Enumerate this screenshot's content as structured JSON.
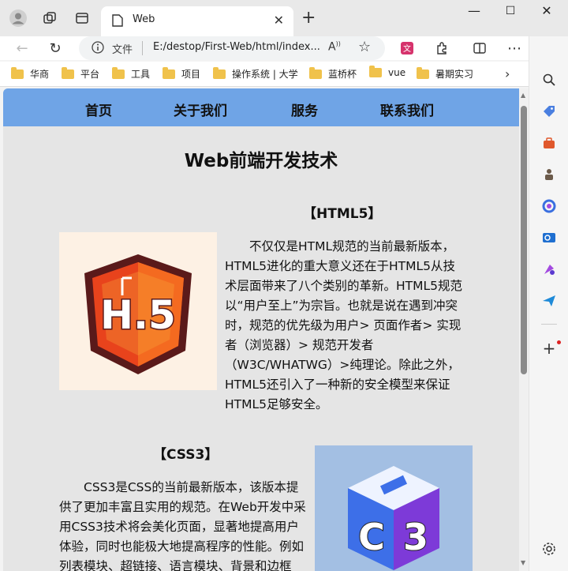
{
  "browser": {
    "tab_title": "Web",
    "address_label": "文件",
    "url": "E:/destop/First-Web/html/index..."
  },
  "bookmarks": [
    "华商",
    "平台",
    "工具",
    "项目",
    "操作系统 | 大学",
    "蓝桥杯",
    "vue",
    "暑期实习"
  ],
  "page": {
    "nav": [
      "首页",
      "关于我们",
      "服务",
      "联系我们"
    ],
    "title": "Web前端开发技术",
    "html5": {
      "title": "【HTML5】",
      "image_text": "H.5",
      "paragraph": "不仅仅是HTML规范的当前最新版本，HTML5进化的重大意义还在于HTML5从技术层面带来了八个类别的革新。HTML5规范以“用户至上”为宗旨。也就是说在遇到冲突时，规范的优先级为用户> 页面作者> 实现者（浏览器）> 规范开发者（W3C/WHATWG）>纯理论。除此之外，HTML5还引入了一种新的安全模型来保证HTML5足够安全。"
    },
    "css3": {
      "title": "【CSS3】",
      "image_text": "C3",
      "paragraph": "CSS3是CSS的当前最新版本，该版本提供了更加丰富且实用的规范。在Web开发中采用CSS3技术将会美化页面，显著地提高用户体验，同时也能极大地提高程序的性能。例如列表模块、超链接、语言模块、背景和边框"
    }
  },
  "icons": {
    "profile": "avatar-icon",
    "workspaces": "workspaces-icon",
    "tab_actions": "tab-actions-icon",
    "sidebar": [
      "search-icon",
      "tag-icon",
      "toolbox-icon",
      "games-icon",
      "office-icon",
      "outlook-icon",
      "designer-icon",
      "send-icon",
      "add-icon",
      "settings-icon"
    ]
  },
  "colors": {
    "nav_bg": "#6fa4e6",
    "page_bg": "#e5e5e5",
    "folder": "#f0c24b"
  }
}
